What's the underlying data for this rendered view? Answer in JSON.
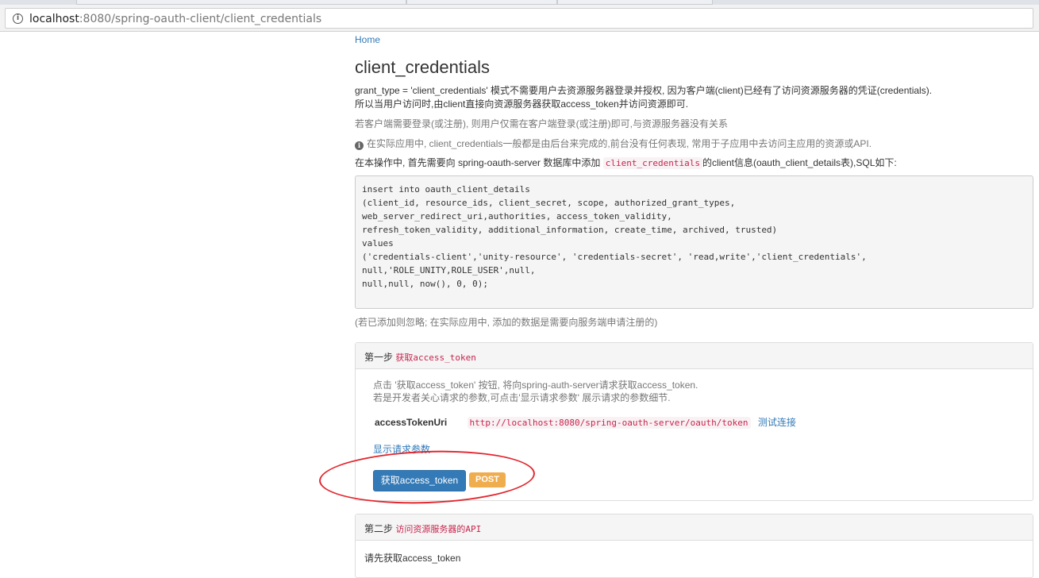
{
  "browser": {
    "url_host": "localhost",
    "url_rest": ":8080/spring-oauth-client/client_credentials"
  },
  "page": {
    "home_link": "Home",
    "title": "client_credentials",
    "intro_line1": "grant_type = 'client_credentials' 模式不需要用户去资源服务器登录并授权, 因为客户端(client)已经有了访问资源服务器的凭证(credentials).",
    "intro_line2": "所以当用户访问时,由client直接向资源服务器获取access_token并访问资源即可.",
    "hint": "若客户端需要登录(或注册), 则用户仅需在客户端登录(或注册)即可,与资源服务器没有关系",
    "info": "在实际应用中, client_credentials一般都是由后台来完成的,前台没有任何表现, 常用于子应用中去访问主应用的资源或API.",
    "op_prefix": "在本操作中, 首先需要向 spring-oauth-server 数据库中添加",
    "op_code": "client_credentials",
    "op_suffix": "的client信息(oauth_client_details表),SQL如下:",
    "sql": "insert into oauth_client_details\n(client_id, resource_ids, client_secret, scope, authorized_grant_types,\nweb_server_redirect_uri,authorities, access_token_validity,\nrefresh_token_validity, additional_information, create_time, archived, trusted)\nvalues\n('credentials-client','unity-resource', 'credentials-secret', 'read,write','client_credentials',\nnull,'ROLE_UNITY,ROLE_USER',null,\nnull,null, now(), 0, 0);",
    "note": "(若已添加则忽略; 在实际应用中, 添加的数据是需要向服务端申请注册的)"
  },
  "step1": {
    "label": "第一步",
    "title": "获取access_token",
    "desc_line1": "点击 '获取access_token' 按钮, 将向spring-auth-server请求获取access_token.",
    "desc_line2": "若是开发者关心请求的参数,可点击'显示请求参数' 展示请求的参数细节.",
    "uri_label": "accessTokenUri",
    "uri_value": "http://localhost:8080/spring-oauth-server/oauth/token",
    "test_link": "测试连接",
    "show_params": "显示请求参数",
    "button": "获取access_token",
    "method_badge": "POST"
  },
  "step2": {
    "label": "第二步",
    "title": "访问资源服务器的API",
    "body": "请先获取access_token"
  },
  "colors": {
    "link": "#337ab7",
    "code": "#c7254e",
    "primary": "#337ab7",
    "warning": "#f0ad4e",
    "annotation": "#e3262e"
  }
}
